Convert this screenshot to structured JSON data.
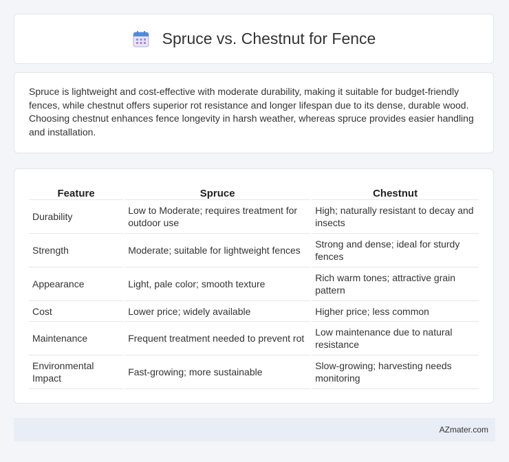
{
  "header": {
    "title": "Spruce vs. Chestnut for Fence",
    "icon": "calendar-icon"
  },
  "summary": {
    "text": "Spruce is lightweight and cost-effective with moderate durability, making it suitable for budget-friendly fences, while chestnut offers superior rot resistance and longer lifespan due to its dense, durable wood. Choosing chestnut enhances fence longevity in harsh weather, whereas spruce provides easier handling and installation."
  },
  "table": {
    "headers": [
      "Feature",
      "Spruce",
      "Chestnut"
    ],
    "rows": [
      [
        "Durability",
        "Low to Moderate; requires treatment for outdoor use",
        "High; naturally resistant to decay and insects"
      ],
      [
        "Strength",
        "Moderate; suitable for lightweight fences",
        "Strong and dense; ideal for sturdy fences"
      ],
      [
        "Appearance",
        "Light, pale color; smooth texture",
        "Rich warm tones; attractive grain pattern"
      ],
      [
        "Cost",
        "Lower price; widely available",
        "Higher price; less common"
      ],
      [
        "Maintenance",
        "Frequent treatment needed to prevent rot",
        "Low maintenance due to natural resistance"
      ],
      [
        "Environmental Impact",
        "Fast-growing; more sustainable",
        "Slow-growing; harvesting needs monitoring"
      ]
    ]
  },
  "footer": {
    "brand": "AZmater.com"
  }
}
